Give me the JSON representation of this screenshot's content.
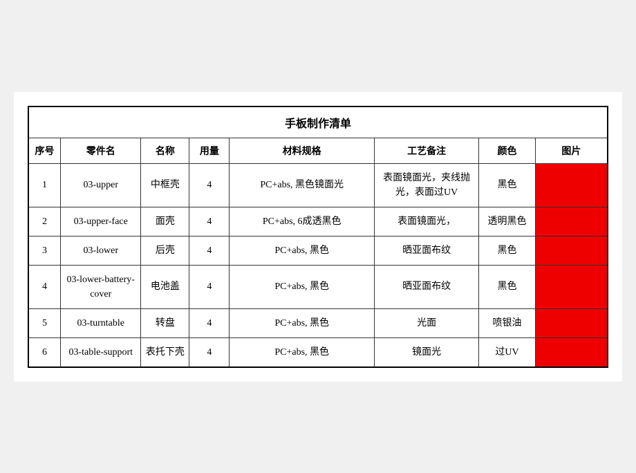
{
  "table": {
    "title": "手板制作清单",
    "headers": [
      "序号",
      "零件名",
      "名称",
      "用量",
      "材料规格",
      "工艺备注",
      "颜色",
      "图片"
    ],
    "rows": [
      {
        "seq": "1",
        "part": "03-upper",
        "name": "中框壳",
        "qty": "4",
        "spec": "PC+abs, 黑色镜面光",
        "process": "表面镜面光，夹线抛光，表面过UV",
        "color": "黑色",
        "hasImg": true
      },
      {
        "seq": "2",
        "part": "03-upper-face",
        "name": "面壳",
        "qty": "4",
        "spec": "PC+abs, 6成透黑色",
        "process": "表面镜面光，",
        "color": "透明黑色",
        "hasImg": true
      },
      {
        "seq": "3",
        "part": "03-lower",
        "name": "后壳",
        "qty": "4",
        "spec": "PC+abs, 黑色",
        "process": "晒亚面布纹",
        "color": "黑色",
        "hasImg": true
      },
      {
        "seq": "4",
        "part": "03-lower-battery-cover",
        "name": "电池盖",
        "qty": "4",
        "spec": "PC+abs, 黑色",
        "process": "晒亚面布纹",
        "color": "黑色",
        "hasImg": true
      },
      {
        "seq": "5",
        "part": "03-turntable",
        "name": "转盘",
        "qty": "4",
        "spec": "PC+abs, 黑色",
        "process": "光面",
        "color": "喷银油",
        "hasImg": true
      },
      {
        "seq": "6",
        "part": "03-table-support",
        "name": "表托下壳",
        "qty": "4",
        "spec": "PC+abs, 黑色",
        "process": "镜面光",
        "color": "过UV",
        "hasImg": true
      }
    ]
  }
}
